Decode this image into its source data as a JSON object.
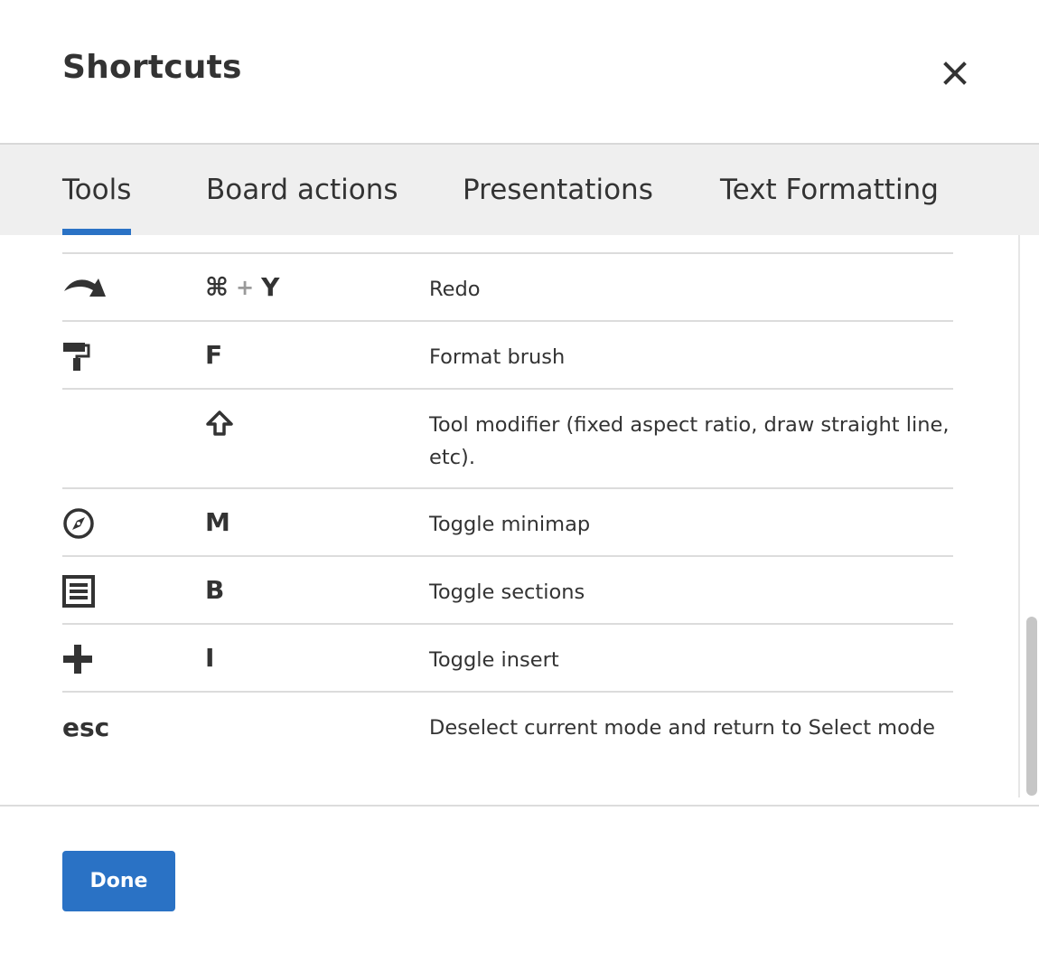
{
  "dialog": {
    "title": "Shortcuts",
    "close_icon": "close-icon"
  },
  "tabs": [
    {
      "label": "Tools",
      "active": true
    },
    {
      "label": "Board actions",
      "active": false
    },
    {
      "label": "Presentations",
      "active": false
    },
    {
      "label": "Text Formatting",
      "active": false
    }
  ],
  "shortcuts": [
    {
      "icon": "redo-icon",
      "keys": [
        "⌘",
        "+",
        "Y"
      ],
      "description": "Redo"
    },
    {
      "icon": "format-brush-icon",
      "keys": [
        "F"
      ],
      "description": "Format brush"
    },
    {
      "icon": "",
      "keys": [
        "shift-icon"
      ],
      "description": "Tool modifier (fixed aspect ratio, draw straight line, etc)."
    },
    {
      "icon": "compass-icon",
      "keys": [
        "M"
      ],
      "description": "Toggle minimap"
    },
    {
      "icon": "sections-icon",
      "keys": [
        "B"
      ],
      "description": "Toggle sections"
    },
    {
      "icon": "plus-icon",
      "keys": [
        "I"
      ],
      "description": "Toggle insert"
    },
    {
      "icon": "esc",
      "keys": [],
      "description": "Deselect current mode and return to Select mode"
    }
  ],
  "footer": {
    "done_label": "Done"
  },
  "colors": {
    "accent": "#2a72c5",
    "tab_bar": "#efefef",
    "text": "#333333"
  }
}
